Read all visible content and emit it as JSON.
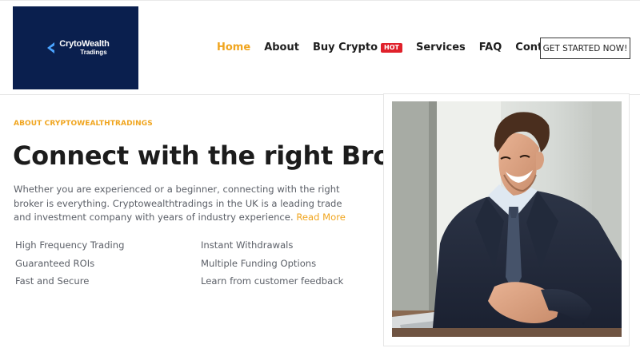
{
  "header": {
    "logo": {
      "name": "CrytoWealth",
      "sub": "Tradings",
      "icon": "arrow-left-icon",
      "bg_color": "#0a1f4e"
    },
    "nav": [
      {
        "label": "Home",
        "active": true
      },
      {
        "label": "About",
        "active": false
      },
      {
        "label": "Buy Crypto",
        "active": false,
        "badge": "HOT"
      },
      {
        "label": "Services",
        "active": false
      },
      {
        "label": "FAQ",
        "active": false
      },
      {
        "label": "Contact",
        "active": false
      }
    ],
    "cta_label": "GET STARTED NOW!"
  },
  "hero": {
    "eyebrow": "ABOUT CRYPTOWEALTHTRADINGS",
    "headline": "Connect with the right Broker.",
    "intro": "Whether you are experienced or a beginner, connecting with the right broker is everything. Cryptowealthtradings in the UK is a leading trade and investment company with years of industry experience.",
    "read_more": "Read More",
    "features": [
      "High Frequency Trading",
      "Instant Withdrawals",
      "Guaranteed ROIs",
      "Multiple Funding Options",
      "Fast and Secure",
      "Learn from customer feedback"
    ],
    "photo": "smiling-businessman-photo"
  },
  "colors": {
    "accent": "#f0a51f",
    "hot_badge": "#e0212b",
    "heading": "#1c1c1c",
    "body_text": "#5c6068"
  }
}
